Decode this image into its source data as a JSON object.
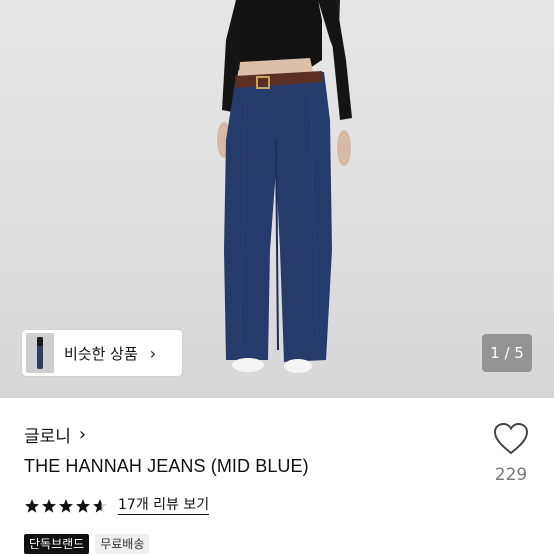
{
  "gallery": {
    "similar_label": "비슷한 상품",
    "similar_chevron": "›",
    "page_indicator": "1 / 5"
  },
  "product": {
    "brand": "글로니",
    "brand_chevron": "›",
    "title": "THE HANNAH JEANS (MID BLUE)",
    "rating": 4.6,
    "review_link": "17개 리뷰 보기",
    "badges": [
      "단독브랜드",
      "무료배송"
    ],
    "like_count": "229"
  },
  "colors": {
    "denim": "#243b6b",
    "top": "#111111",
    "belt": "#5a2f22",
    "accent": "#111111"
  }
}
